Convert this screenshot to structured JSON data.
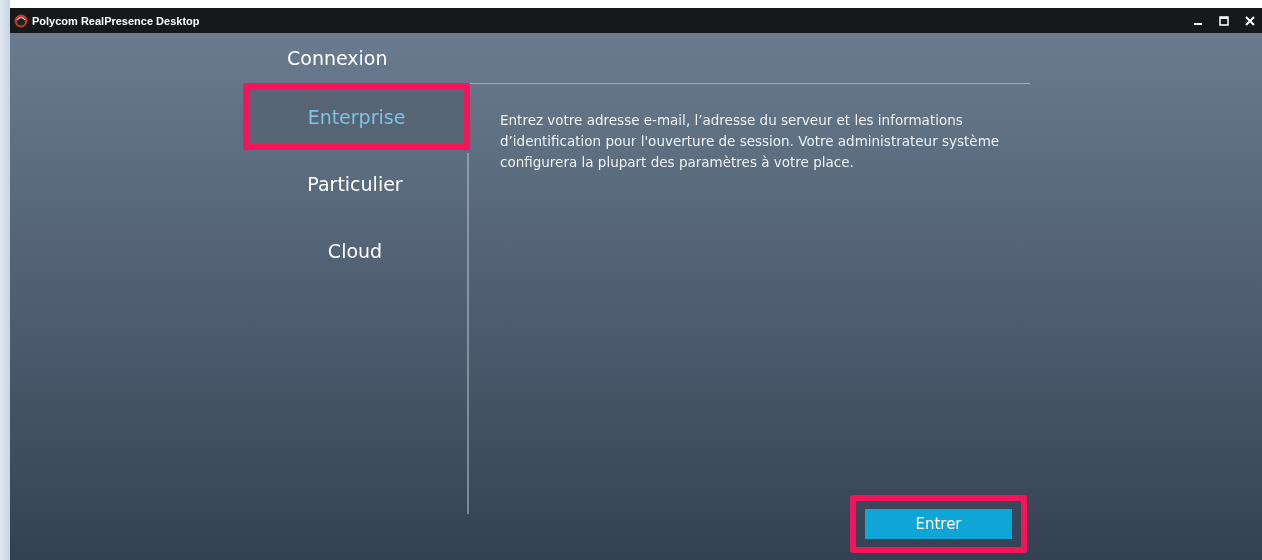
{
  "window": {
    "title": "Polycom RealPresence Desktop",
    "controls": [
      {
        "kind": "minimize"
      },
      {
        "kind": "maximize"
      },
      {
        "kind": "close"
      }
    ]
  },
  "heading": "Connexion",
  "nav": [
    {
      "label": "Enterprise",
      "selected": true,
      "highlighted": true
    },
    {
      "label": "Particulier",
      "selected": false,
      "highlighted": false
    },
    {
      "label": "Cloud",
      "selected": false,
      "highlighted": false
    }
  ],
  "description": "Entrez votre adresse e-mail, l’adresse du serveur et les informations d’identification pour l'ouverture de session. Votre administrateur système configurera la plupart des paramètres à votre place.",
  "button": {
    "label": "Entrer",
    "highlighted": true
  }
}
